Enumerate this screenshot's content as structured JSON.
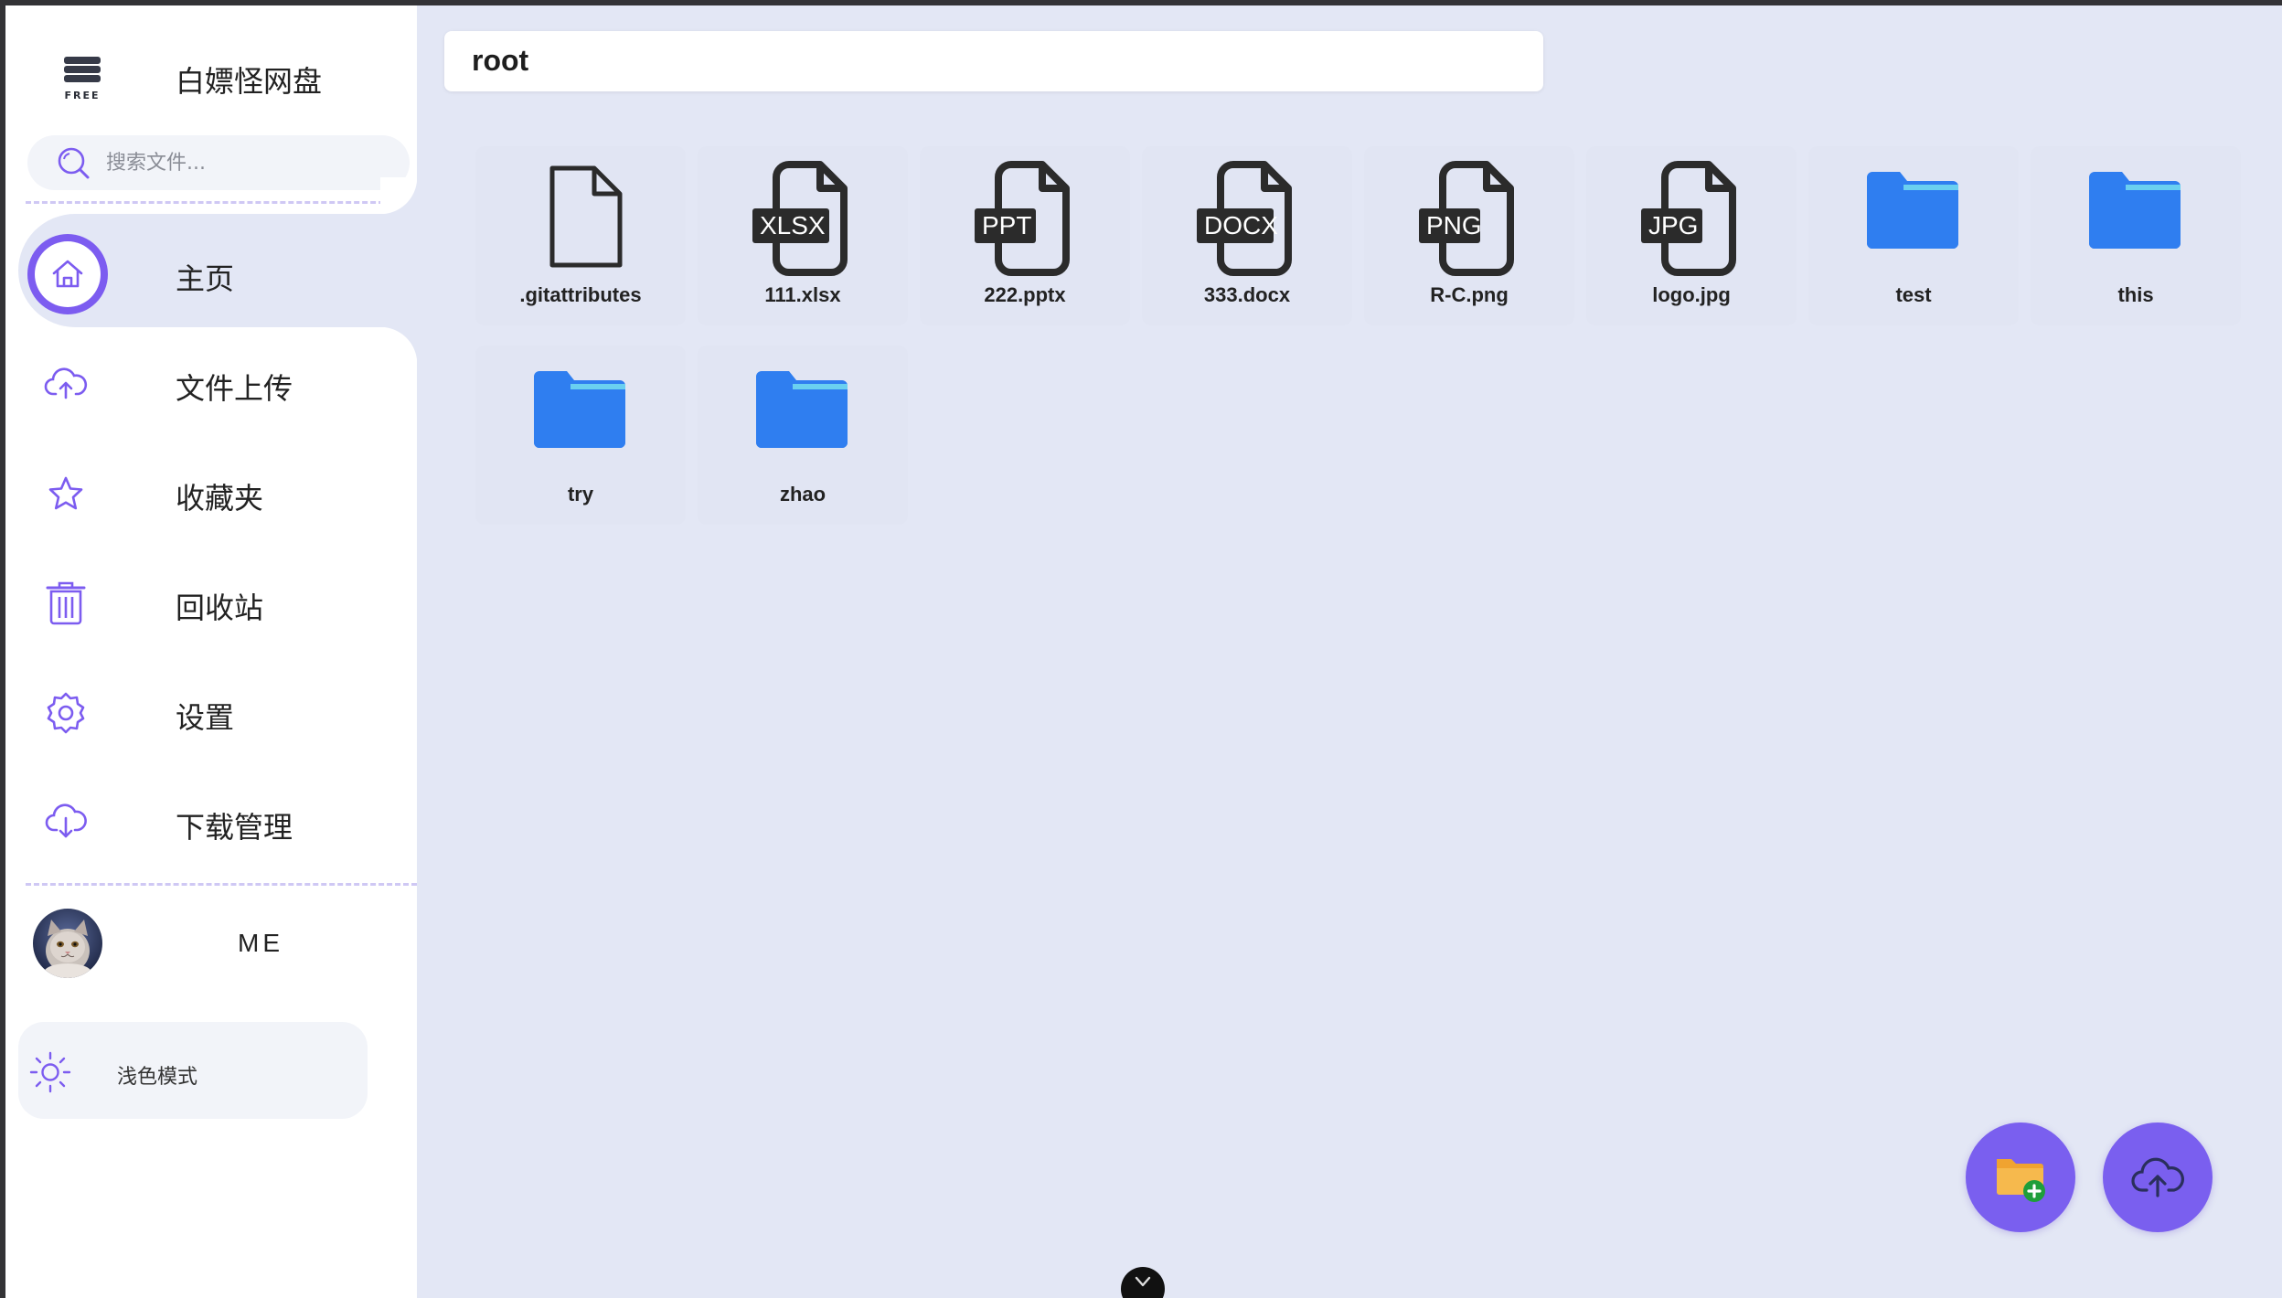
{
  "app": {
    "title": "白嫖怪网盘",
    "logo_text": "FREE",
    "accent_color": "#7c5cf0"
  },
  "search": {
    "placeholder": "搜索文件..."
  },
  "nav": {
    "items": [
      {
        "label": "主页",
        "icon": "home-icon",
        "active": true
      },
      {
        "label": "文件上传",
        "icon": "cloud-upload-icon",
        "active": false
      },
      {
        "label": "收藏夹",
        "icon": "star-icon",
        "active": false
      },
      {
        "label": "回收站",
        "icon": "trash-icon",
        "active": false
      },
      {
        "label": "设置",
        "icon": "gear-icon",
        "active": false
      },
      {
        "label": "下载管理",
        "icon": "cloud-download-icon",
        "active": false
      }
    ]
  },
  "user": {
    "name": "ME"
  },
  "theme_toggle": {
    "label": "浅色模式",
    "icon": "sun-icon"
  },
  "path": {
    "current": "root"
  },
  "files": [
    {
      "name": ".gitattributes",
      "type": "file",
      "badge": ""
    },
    {
      "name": "111.xlsx",
      "type": "file",
      "badge": "XLSX"
    },
    {
      "name": "222.pptx",
      "type": "file",
      "badge": "PPT"
    },
    {
      "name": "333.docx",
      "type": "file",
      "badge": "DOCX"
    },
    {
      "name": "R-C.png",
      "type": "file",
      "badge": "PNG"
    },
    {
      "name": "logo.jpg",
      "type": "file",
      "badge": "JPG"
    },
    {
      "name": "test",
      "type": "folder",
      "badge": ""
    },
    {
      "name": "this",
      "type": "folder",
      "badge": ""
    },
    {
      "name": "try",
      "type": "folder",
      "badge": ""
    },
    {
      "name": "zhao",
      "type": "folder",
      "badge": ""
    }
  ],
  "actions": {
    "new_folder_icon": "folder-add-icon",
    "upload_icon": "cloud-upload-icon",
    "folder_color": "#2f7ef0",
    "file_icon_color": "#2b2b2b"
  }
}
